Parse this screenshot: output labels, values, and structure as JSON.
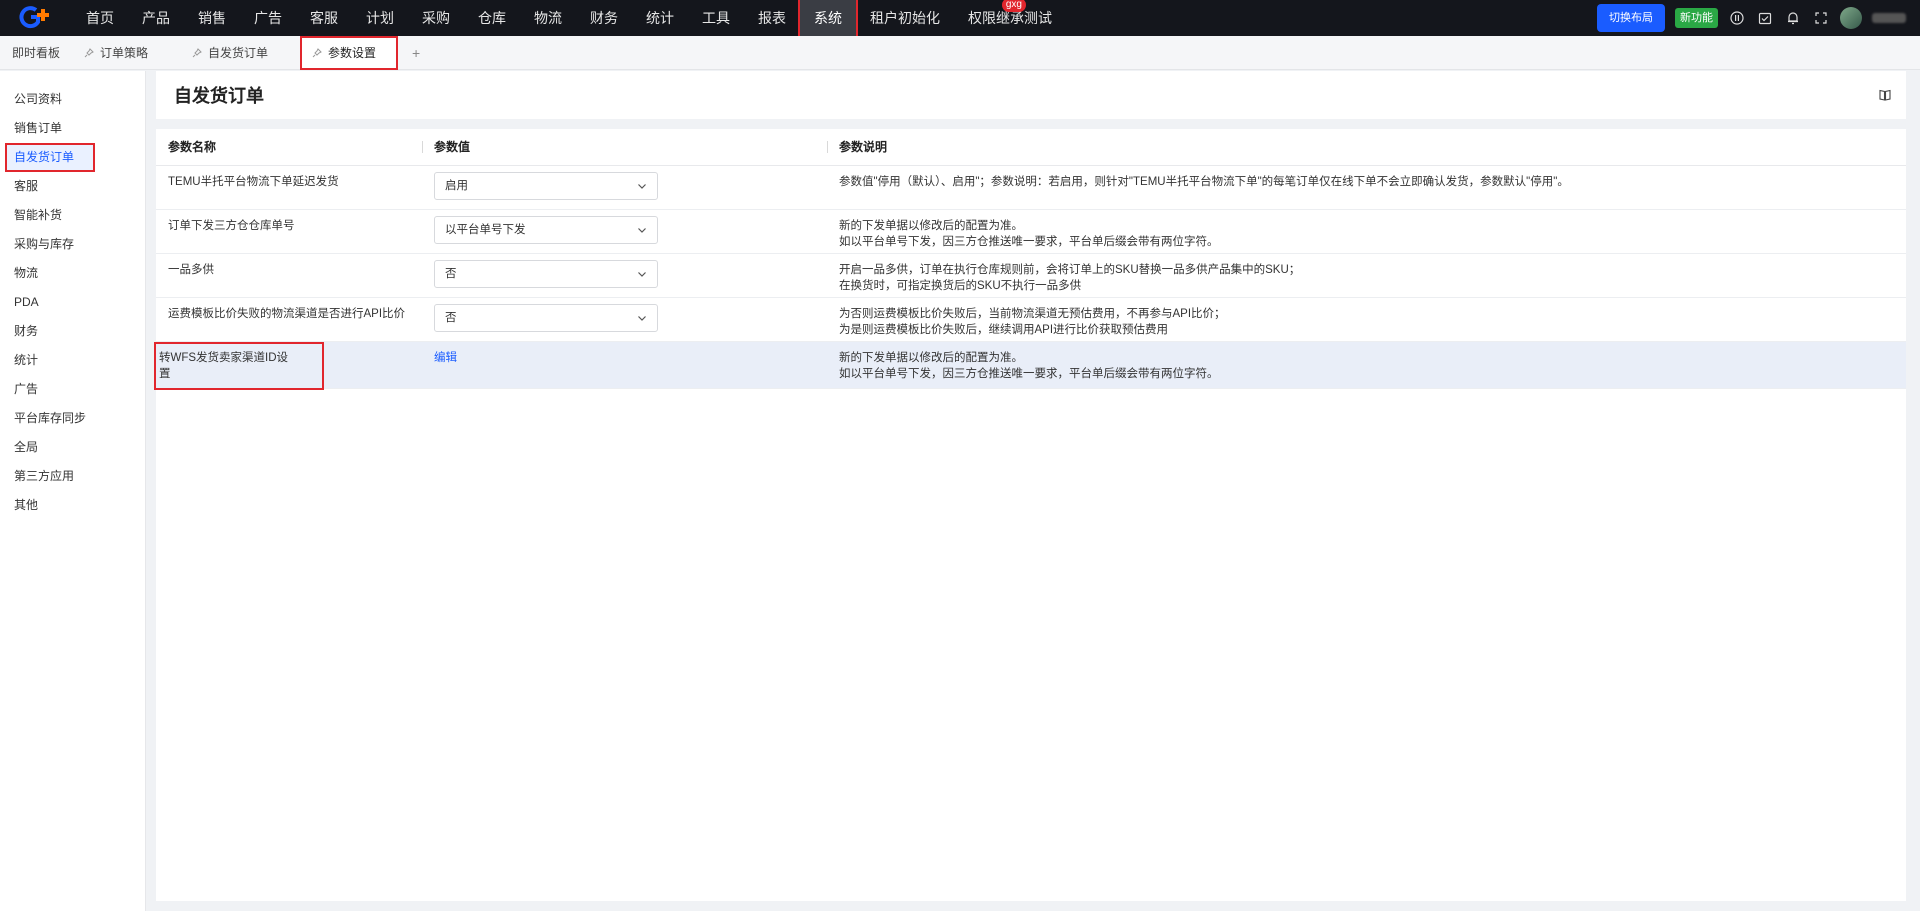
{
  "nav": {
    "items": [
      {
        "label": "首页"
      },
      {
        "label": "产品"
      },
      {
        "label": "销售"
      },
      {
        "label": "广告"
      },
      {
        "label": "客服"
      },
      {
        "label": "计划"
      },
      {
        "label": "采购"
      },
      {
        "label": "仓库"
      },
      {
        "label": "物流"
      },
      {
        "label": "财务"
      },
      {
        "label": "统计"
      },
      {
        "label": "工具"
      },
      {
        "label": "报表"
      },
      {
        "label": "系统",
        "active": true
      },
      {
        "label": "租户初始化"
      },
      {
        "label": "权限继承测试",
        "badge": "gxg"
      }
    ],
    "switch_layout": "切换布局",
    "new_feature": "新功能"
  },
  "tabs": [
    {
      "label": "即时看板"
    },
    {
      "label": "订单策略"
    },
    {
      "label": "自发货订单"
    },
    {
      "label": "参数设置",
      "active": true
    }
  ],
  "tab_add": "+",
  "sidebar": {
    "items": [
      {
        "label": "公司资料"
      },
      {
        "label": "销售订单"
      },
      {
        "label": "自发货订单",
        "active": true
      },
      {
        "label": "客服"
      },
      {
        "label": "智能补货"
      },
      {
        "label": "采购与库存"
      },
      {
        "label": "物流"
      },
      {
        "label": "PDA"
      },
      {
        "label": "财务"
      },
      {
        "label": "统计"
      },
      {
        "label": "广告"
      },
      {
        "label": "平台库存同步"
      },
      {
        "label": "全局"
      },
      {
        "label": "第三方应用"
      },
      {
        "label": "其他"
      }
    ]
  },
  "page": {
    "title": "自发货订单"
  },
  "table": {
    "headers": [
      "参数名称",
      "参数值",
      "参数说明"
    ],
    "rows": [
      {
        "name": "TEMU半托平台物流下单延迟发货",
        "value": "启用",
        "desc1": "参数值\"停用（默认）、启用\"；参数说明：若启用，则针对\"TEMU半托平台物流下单\"的每笔订单仅在线下单不会立即确认发货，参数默认\"停用\"。",
        "desc2": ""
      },
      {
        "name": "订单下发三方仓仓库单号",
        "value": "以平台单号下发",
        "desc1": "新的下发单据以修改后的配置为准。",
        "desc2": "如以平台单号下发，因三方仓推送唯一要求，平台单后缀会带有两位字符。"
      },
      {
        "name": "一品多供",
        "value": "否",
        "desc1": "开启一品多供，订单在执行仓库规则前，会将订单上的SKU替换一品多供产品集中的SKU；",
        "desc2": "在换货时，可指定换货后的SKU不执行一品多供"
      },
      {
        "name": "运费模板比价失败的物流渠道是否进行API比价",
        "value": "否",
        "desc1": "为否则运费模板比价失败后，当前物流渠道无预估费用，不再参与API比价；",
        "desc2": "为是则运费模板比价失败后，继续调用API进行比价获取预估费用"
      },
      {
        "name": "转WFS发货卖家渠道ID设置",
        "link": "编辑",
        "desc1": "新的下发单据以修改后的配置为准。",
        "desc2": "如以平台单号下发，因三方仓推送唯一要求，平台单后缀会带有两位字符。"
      }
    ]
  },
  "colors": {
    "accent": "#1a5cff",
    "highlight": "#e1262d",
    "topbar": "#14161c",
    "new_badge": "#2aa845"
  }
}
